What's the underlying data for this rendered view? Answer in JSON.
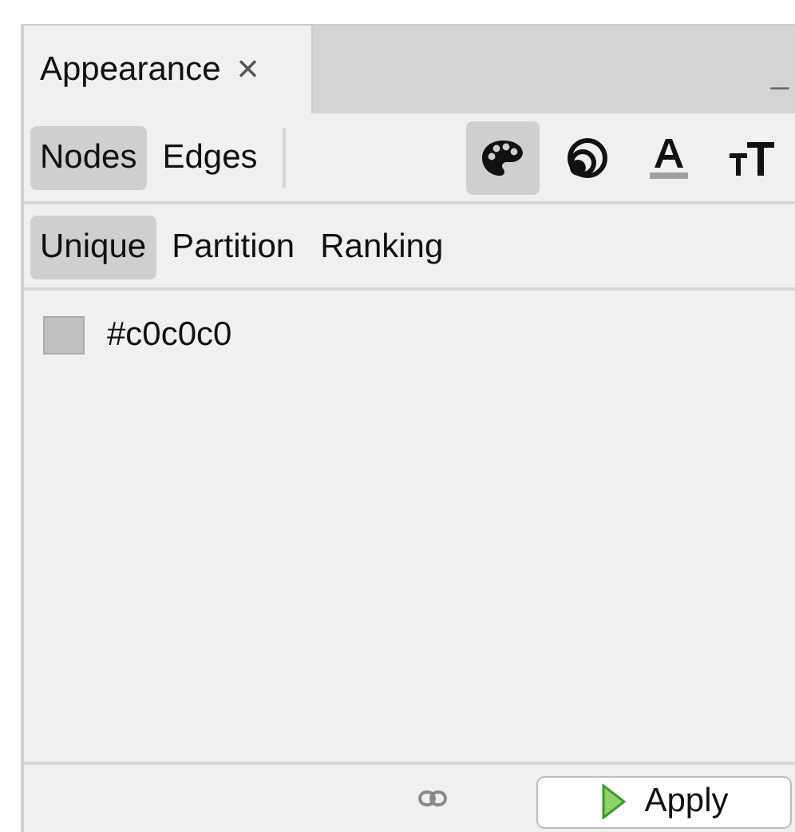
{
  "tab": {
    "title": "Appearance",
    "close": "×",
    "minimize": "_"
  },
  "element_tabs": [
    {
      "label": "Nodes",
      "selected": true
    },
    {
      "label": "Edges",
      "selected": false
    }
  ],
  "attribute_buttons": [
    {
      "kind": "color",
      "selected": true
    },
    {
      "kind": "size",
      "selected": false
    },
    {
      "kind": "label-color",
      "selected": false
    },
    {
      "kind": "label-size",
      "selected": false
    }
  ],
  "mode_tabs": [
    {
      "label": "Unique",
      "selected": true
    },
    {
      "label": "Partition",
      "selected": false
    },
    {
      "label": "Ranking",
      "selected": false
    }
  ],
  "unique": {
    "color": "#c0c0c0",
    "value": "#c0c0c0"
  },
  "apply_button": "Apply"
}
